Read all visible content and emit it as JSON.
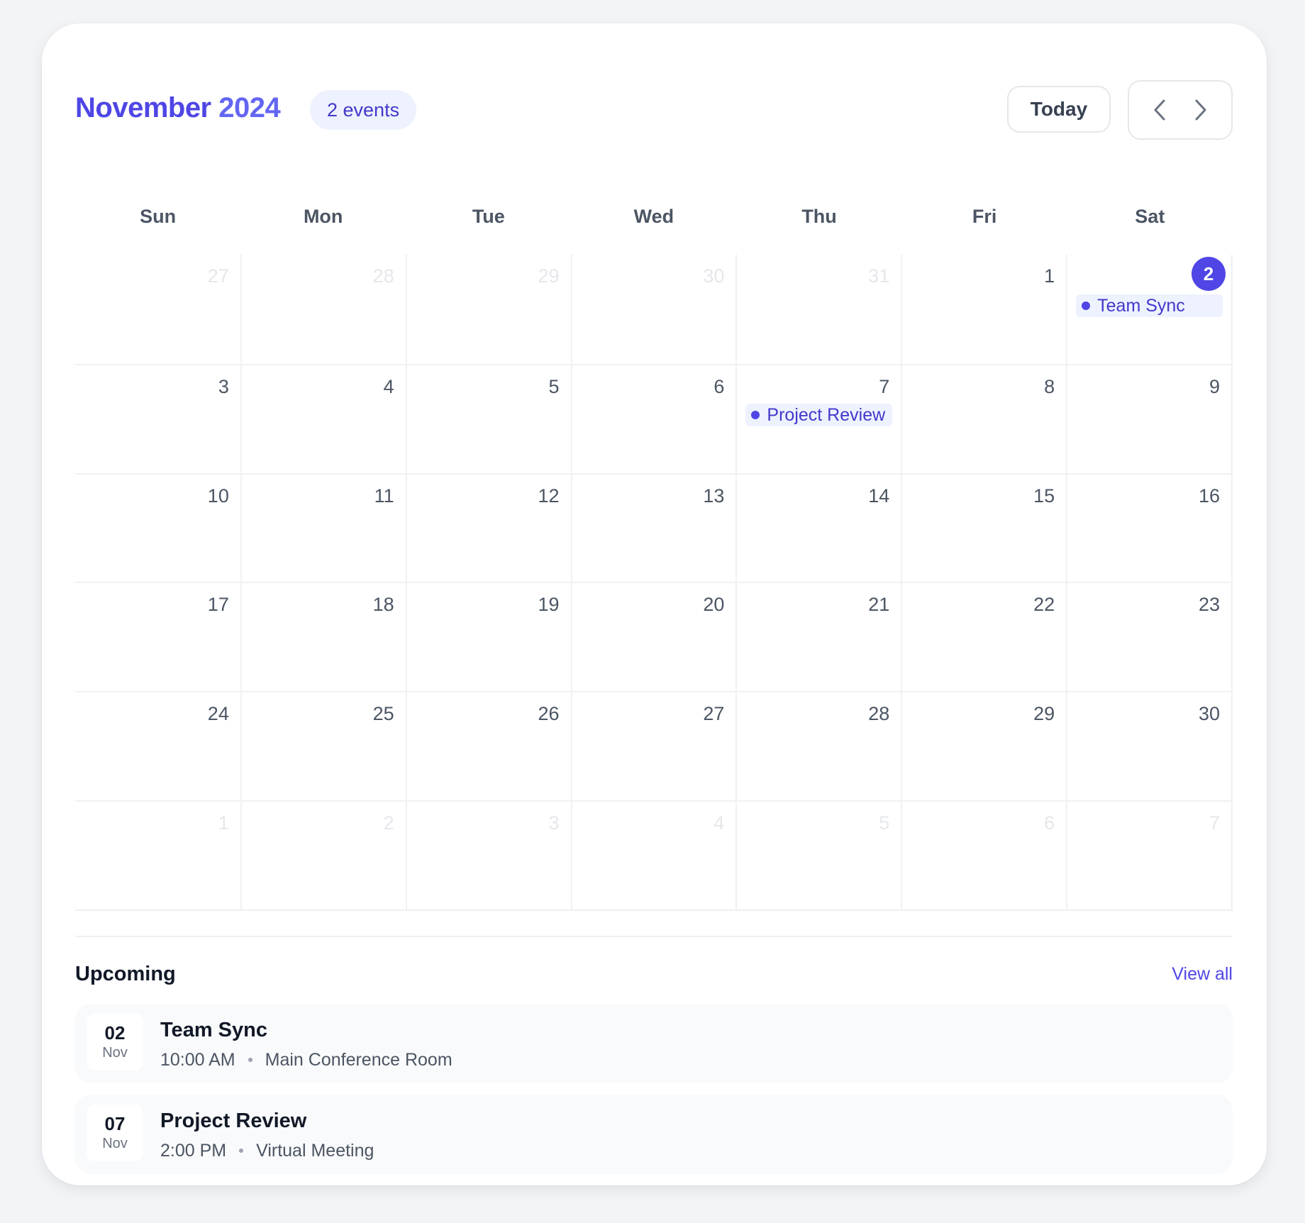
{
  "header": {
    "month": "November",
    "year": "2024",
    "badge": "2 events",
    "today_label": "Today",
    "prev_icon": "chevron-left-icon",
    "next_icon": "chevron-right-icon"
  },
  "weekdays": [
    "Sun",
    "Mon",
    "Tue",
    "Wed",
    "Thu",
    "Fri",
    "Sat"
  ],
  "days": [
    {
      "num": "27",
      "muted": true
    },
    {
      "num": "28",
      "muted": true
    },
    {
      "num": "29",
      "muted": true
    },
    {
      "num": "30",
      "muted": true
    },
    {
      "num": "31",
      "muted": true
    },
    {
      "num": "1"
    },
    {
      "num": "2",
      "today": true,
      "event": "Team Sync"
    },
    {
      "num": "3"
    },
    {
      "num": "4"
    },
    {
      "num": "5"
    },
    {
      "num": "6"
    },
    {
      "num": "7",
      "event": "Project Review"
    },
    {
      "num": "8"
    },
    {
      "num": "9"
    },
    {
      "num": "10"
    },
    {
      "num": "11"
    },
    {
      "num": "12"
    },
    {
      "num": "13"
    },
    {
      "num": "14"
    },
    {
      "num": "15"
    },
    {
      "num": "16"
    },
    {
      "num": "17"
    },
    {
      "num": "18"
    },
    {
      "num": "19"
    },
    {
      "num": "20"
    },
    {
      "num": "21"
    },
    {
      "num": "22"
    },
    {
      "num": "23"
    },
    {
      "num": "24"
    },
    {
      "num": "25"
    },
    {
      "num": "26"
    },
    {
      "num": "27"
    },
    {
      "num": "28"
    },
    {
      "num": "29"
    },
    {
      "num": "30"
    },
    {
      "num": "1",
      "muted": true
    },
    {
      "num": "2",
      "muted": true
    },
    {
      "num": "3",
      "muted": true
    },
    {
      "num": "4",
      "muted": true
    },
    {
      "num": "5",
      "muted": true
    },
    {
      "num": "6",
      "muted": true
    },
    {
      "num": "7",
      "muted": true
    }
  ],
  "upcoming": {
    "title": "Upcoming",
    "view_all": "View all",
    "events": [
      {
        "day": "02",
        "month": "Nov",
        "title": "Team Sync",
        "time": "10:00 AM",
        "location": "Main Conference Room"
      },
      {
        "day": "07",
        "month": "Nov",
        "title": "Project Review",
        "time": "2:00 PM",
        "location": "Virtual Meeting"
      }
    ]
  },
  "colors": {
    "accent": "#4f46e5",
    "accent_light": "#eef2ff",
    "background": "#f3f4f6"
  }
}
